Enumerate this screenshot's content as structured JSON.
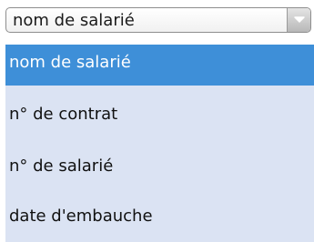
{
  "combo": {
    "value": "nom de salarié",
    "arrow_icon": "chevron-down-icon"
  },
  "list": {
    "items": [
      {
        "label": "nom de salarié",
        "selected": true
      },
      {
        "label": "n° de contrat",
        "selected": false
      },
      {
        "label": "n° de salarié",
        "selected": false
      },
      {
        "label": "date d'embauche",
        "selected": false
      }
    ]
  },
  "colors": {
    "highlight": "#3e8fd8",
    "list_background": "#dbe3f3",
    "combo_border": "#8e8e8e"
  }
}
